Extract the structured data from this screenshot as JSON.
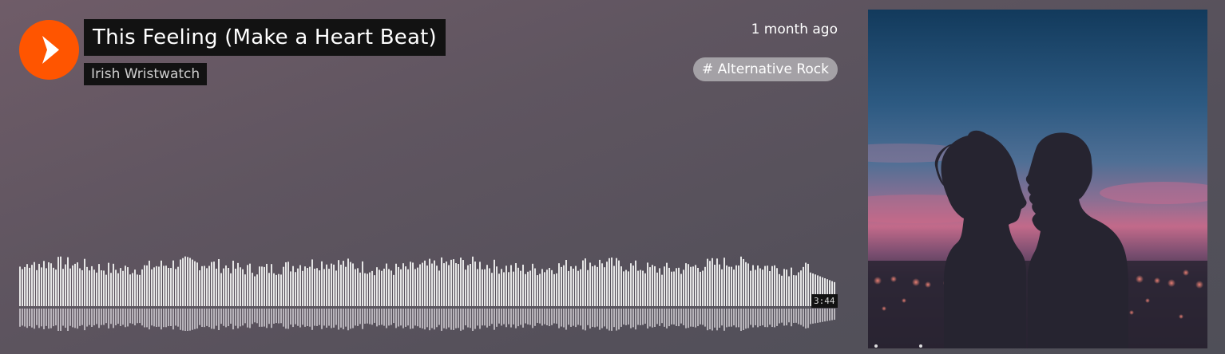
{
  "track": {
    "title": "This Feeling (Make a Heart Beat)",
    "artist": "Irish Wristwatch",
    "uploaded": "1 month ago",
    "tag": "# Alternative Rock",
    "duration": "3:44"
  },
  "icons": {
    "play": "play-icon",
    "artwork": "album-artwork-couple-silhouette"
  },
  "colors": {
    "accent": "#ff5500",
    "label_bg": "#121212",
    "tag_bg": "#a4a1a6",
    "waveform": "#e6e6e6"
  },
  "playback": {
    "progress": 0
  }
}
